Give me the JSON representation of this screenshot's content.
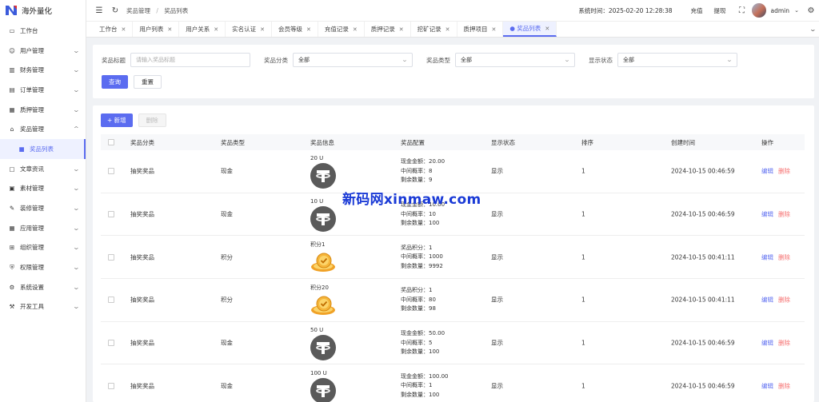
{
  "app": {
    "name": "海外量化"
  },
  "sidebar": {
    "items": [
      {
        "label": "工作台",
        "icon": "monitor-icon",
        "expandable": false
      },
      {
        "label": "用户管理",
        "icon": "user-icon",
        "expandable": true
      },
      {
        "label": "财务管理",
        "icon": "chart-icon",
        "expandable": true
      },
      {
        "label": "订单管理",
        "icon": "order-icon",
        "expandable": true
      },
      {
        "label": "质押管理",
        "icon": "document-icon",
        "expandable": true
      },
      {
        "label": "奖品管理",
        "icon": "gift-icon",
        "expandable": true,
        "expanded": true
      },
      {
        "label": "奖品列表",
        "icon": "lock-icon",
        "sub": true,
        "active": true
      },
      {
        "label": "文章资讯",
        "icon": "article-icon",
        "expandable": true
      },
      {
        "label": "素材管理",
        "icon": "image-icon",
        "expandable": true
      },
      {
        "label": "装修管理",
        "icon": "brush-icon",
        "expandable": true
      },
      {
        "label": "应用管理",
        "icon": "app-icon",
        "expandable": true
      },
      {
        "label": "组织管理",
        "icon": "org-icon",
        "expandable": true
      },
      {
        "label": "权限管理",
        "icon": "shield-icon",
        "expandable": true
      },
      {
        "label": "系统设置",
        "icon": "gear-icon",
        "expandable": true
      },
      {
        "label": "开发工具",
        "icon": "code-icon",
        "expandable": true
      }
    ]
  },
  "header": {
    "breadcrumb": [
      "奖品管理",
      "奖品列表"
    ],
    "system_time": "系统时间：2025-02-20 12:28:38",
    "recharge": "充值",
    "withdraw": "提现",
    "username": "admin"
  },
  "tabs": [
    {
      "label": "工作台"
    },
    {
      "label": "用户列表"
    },
    {
      "label": "用户关系"
    },
    {
      "label": "实名认证"
    },
    {
      "label": "会员等级"
    },
    {
      "label": "充值记录"
    },
    {
      "label": "质押记录"
    },
    {
      "label": "挖矿记录"
    },
    {
      "label": "质押项目"
    },
    {
      "label": "● 奖品列表",
      "active": true
    }
  ],
  "filter": {
    "title_label": "奖品标题",
    "title_placeholder": "请输入奖品标题",
    "category_label": "奖品分类",
    "category_value": "全部",
    "type_label": "奖品类型",
    "type_value": "全部",
    "status_label": "显示状态",
    "status_value": "全部",
    "search_button": "查询",
    "reset_button": "重置"
  },
  "toolbar": {
    "add_button": "+ 新增",
    "delete_button": "删除"
  },
  "table": {
    "headers": [
      "奖品分类",
      "奖品类型",
      "奖品信息",
      "奖品配置",
      "显示状态",
      "排序",
      "创建时间",
      "操作"
    ],
    "rows": [
      {
        "category": "抽奖奖品",
        "type": "现金",
        "info_label": "20 U",
        "image": "tether-icon",
        "cfg": [
          "现金金额：20.00",
          "中间概率：8",
          "剩余数量：9"
        ],
        "status": "显示",
        "sort": "1",
        "created": "2024-10-15 00:46:59",
        "edit": "编辑",
        "del": "删除"
      },
      {
        "category": "抽奖奖品",
        "type": "现金",
        "info_label": "10 U",
        "image": "tether-icon",
        "cfg": [
          "现金金额：10.00",
          "中间概率：10",
          "剩余数量：100"
        ],
        "status": "显示",
        "sort": "1",
        "created": "2024-10-15 00:46:59",
        "edit": "编辑",
        "del": "删除"
      },
      {
        "category": "抽奖奖品",
        "type": "积分",
        "info_label": "积分1",
        "image": "coin-icon",
        "cfg": [
          "奖品积分：1",
          "中间概率：1000",
          "剩余数量：9992"
        ],
        "status": "显示",
        "sort": "1",
        "created": "2024-10-15 00:41:11",
        "edit": "编辑",
        "del": "删除"
      },
      {
        "category": "抽奖奖品",
        "type": "积分",
        "info_label": "积分20",
        "image": "coin-icon",
        "cfg": [
          "奖品积分：1",
          "中间概率：80",
          "剩余数量：98"
        ],
        "status": "显示",
        "sort": "1",
        "created": "2024-10-15 00:41:11",
        "edit": "编辑",
        "del": "删除"
      },
      {
        "category": "抽奖奖品",
        "type": "现金",
        "info_label": "50 U",
        "image": "tether-icon",
        "cfg": [
          "现金金额：50.00",
          "中间概率：5",
          "剩余数量：100"
        ],
        "status": "显示",
        "sort": "1",
        "created": "2024-10-15 00:46:59",
        "edit": "编辑",
        "del": "删除"
      },
      {
        "category": "抽奖奖品",
        "type": "现金",
        "info_label": "100 U",
        "image": "tether-icon",
        "cfg": [
          "现金金额：100.00",
          "中间概率：1",
          "剩余数量：100"
        ],
        "status": "显示",
        "sort": "1",
        "created": "2024-10-15 00:46:59",
        "edit": "编辑",
        "del": "删除"
      }
    ]
  },
  "watermark": "新码网xinmaw.com",
  "colors": {
    "primary": "#5b6cf0",
    "danger": "#f56c6c",
    "watermark": "#1a3ad6"
  }
}
